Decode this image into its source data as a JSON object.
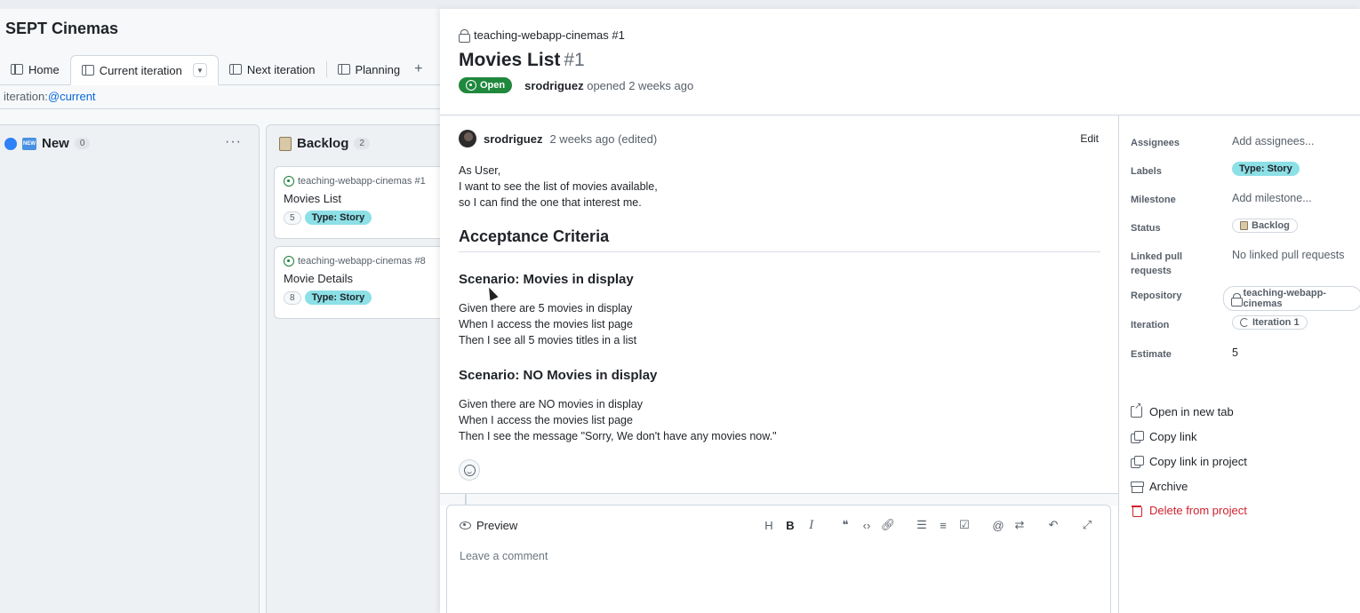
{
  "project": {
    "title": "SEPT Cinemas",
    "tabs": [
      {
        "label": "Home"
      },
      {
        "label": "Current iteration"
      },
      {
        "label": "Next iteration"
      },
      {
        "label": "Planning"
      }
    ],
    "add_tab": "+",
    "filter_key": "iteration:",
    "filter_value": "@current",
    "columns": [
      {
        "name": "New",
        "emoji": "NEW",
        "count": "0",
        "menu": "···"
      },
      {
        "name": "Backlog",
        "count": "2"
      }
    ],
    "cards": [
      {
        "repo": "teaching-webapp-cinemas #1",
        "title": "Movies List",
        "estimate": "5",
        "label": "Type: Story"
      },
      {
        "repo": "teaching-webapp-cinemas #8",
        "title": "Movie Details",
        "estimate": "8",
        "label": "Type: Story"
      }
    ]
  },
  "issue": {
    "repo_ref": "teaching-webapp-cinemas #1",
    "title": "Movies List",
    "number": "#1",
    "state": "Open",
    "author": "srodriguez",
    "opened_text": "opened 2 weeks ago",
    "comment": {
      "author": "srodriguez",
      "time": "2 weeks ago (edited)",
      "edit_label": "Edit",
      "intro": [
        "As User,",
        "I want to see the list of movies available,",
        "so I can find the one that interest me."
      ],
      "heading": "Acceptance Criteria",
      "scenarios": [
        {
          "title": "Scenario: Movies in display",
          "lines": [
            "Given there are 5 movies in display",
            "When I access the movies list page",
            "Then I see all 5 movies titles in a list"
          ]
        },
        {
          "title": "Scenario: NO Movies in display",
          "lines": [
            "Given there are NO movies in display",
            "When I access the movies list page",
            "Then I see the message \"Sorry, We don't have any movies now.\""
          ]
        }
      ]
    },
    "editor": {
      "preview_label": "Preview",
      "placeholder": "Leave a comment",
      "toolbar": [
        "H",
        "B",
        "I"
      ]
    }
  },
  "sidebar": {
    "assignees": {
      "label": "Assignees",
      "value": "Add assignees..."
    },
    "labels": {
      "label": "Labels",
      "value": "Type: Story",
      "color": "#8ce0e6"
    },
    "milestone": {
      "label": "Milestone",
      "value": "Add milestone..."
    },
    "status": {
      "label": "Status",
      "value": "Backlog"
    },
    "linked_prs": {
      "label": "Linked pull requests",
      "value": "No linked pull requests"
    },
    "repository": {
      "label": "Repository",
      "value": "teaching-webapp-cinemas"
    },
    "iteration": {
      "label": "Iteration",
      "value": "Iteration 1"
    },
    "estimate": {
      "label": "Estimate",
      "value": "5"
    }
  },
  "actions": {
    "open_new_tab": "Open in new tab",
    "copy_link": "Copy link",
    "copy_link_project": "Copy link in project",
    "archive": "Archive",
    "delete": "Delete from project"
  },
  "colors": {
    "open_green": "#1f883d",
    "danger_red": "#cf222e",
    "link_blue": "#0969da"
  }
}
